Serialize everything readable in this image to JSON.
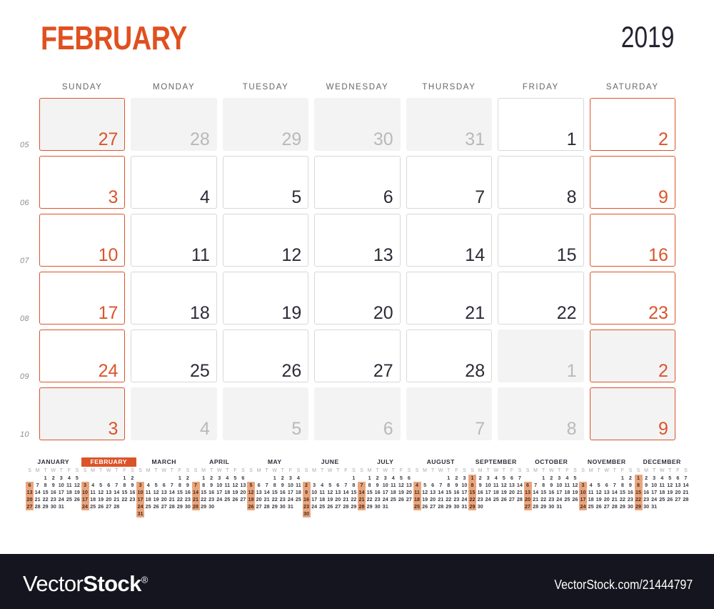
{
  "header": {
    "month": "FEBRUARY",
    "year": "2019",
    "month_color": "#E0501F",
    "year_color": "#232331"
  },
  "accent_color": "#DB5429",
  "weekday_headers": [
    "SUNDAY",
    "MONDAY",
    "TUESDAY",
    "WEDNESDAY",
    "THURSDAY",
    "FRIDAY",
    "SATURDAY"
  ],
  "week_numbers": [
    "05",
    "06",
    "07",
    "08",
    "09",
    "10"
  ],
  "grid": [
    [
      {
        "n": "27",
        "state": "out",
        "weekend": true
      },
      {
        "n": "28",
        "state": "out",
        "weekend": false
      },
      {
        "n": "29",
        "state": "out",
        "weekend": false
      },
      {
        "n": "30",
        "state": "out",
        "weekend": false
      },
      {
        "n": "31",
        "state": "out",
        "weekend": false
      },
      {
        "n": "1",
        "state": "in",
        "weekend": false
      },
      {
        "n": "2",
        "state": "in",
        "weekend": true
      }
    ],
    [
      {
        "n": "3",
        "state": "in",
        "weekend": true
      },
      {
        "n": "4",
        "state": "in",
        "weekend": false
      },
      {
        "n": "5",
        "state": "in",
        "weekend": false
      },
      {
        "n": "6",
        "state": "in",
        "weekend": false
      },
      {
        "n": "7",
        "state": "in",
        "weekend": false
      },
      {
        "n": "8",
        "state": "in",
        "weekend": false
      },
      {
        "n": "9",
        "state": "in",
        "weekend": true
      }
    ],
    [
      {
        "n": "10",
        "state": "in",
        "weekend": true
      },
      {
        "n": "11",
        "state": "in",
        "weekend": false
      },
      {
        "n": "12",
        "state": "in",
        "weekend": false
      },
      {
        "n": "13",
        "state": "in",
        "weekend": false
      },
      {
        "n": "14",
        "state": "in",
        "weekend": false
      },
      {
        "n": "15",
        "state": "in",
        "weekend": false
      },
      {
        "n": "16",
        "state": "in",
        "weekend": true
      }
    ],
    [
      {
        "n": "17",
        "state": "in",
        "weekend": true
      },
      {
        "n": "18",
        "state": "in",
        "weekend": false
      },
      {
        "n": "19",
        "state": "in",
        "weekend": false
      },
      {
        "n": "20",
        "state": "in",
        "weekend": false
      },
      {
        "n": "21",
        "state": "in",
        "weekend": false
      },
      {
        "n": "22",
        "state": "in",
        "weekend": false
      },
      {
        "n": "23",
        "state": "in",
        "weekend": true
      }
    ],
    [
      {
        "n": "24",
        "state": "in",
        "weekend": true
      },
      {
        "n": "25",
        "state": "in",
        "weekend": false
      },
      {
        "n": "26",
        "state": "in",
        "weekend": false
      },
      {
        "n": "27",
        "state": "in",
        "weekend": false
      },
      {
        "n": "28",
        "state": "in",
        "weekend": false
      },
      {
        "n": "1",
        "state": "out",
        "weekend": false
      },
      {
        "n": "2",
        "state": "out",
        "weekend": true
      }
    ],
    [
      {
        "n": "3",
        "state": "out",
        "weekend": true
      },
      {
        "n": "4",
        "state": "out",
        "weekend": false
      },
      {
        "n": "5",
        "state": "out",
        "weekend": false
      },
      {
        "n": "6",
        "state": "out",
        "weekend": false
      },
      {
        "n": "7",
        "state": "out",
        "weekend": false
      },
      {
        "n": "8",
        "state": "out",
        "weekend": false
      },
      {
        "n": "9",
        "state": "out",
        "weekend": true
      }
    ]
  ],
  "mini_dow": [
    "S",
    "M",
    "T",
    "W",
    "T",
    "F",
    "S"
  ],
  "mini_calendars": [
    {
      "name": "JANUARY",
      "current": false,
      "start": 2,
      "days": 31
    },
    {
      "name": "FEBRUARY",
      "current": true,
      "start": 5,
      "days": 28
    },
    {
      "name": "MARCH",
      "current": false,
      "start": 5,
      "days": 31
    },
    {
      "name": "APRIL",
      "current": false,
      "start": 1,
      "days": 30
    },
    {
      "name": "MAY",
      "current": false,
      "start": 3,
      "days": 31
    },
    {
      "name": "JUNE",
      "current": false,
      "start": 6,
      "days": 30
    },
    {
      "name": "JULY",
      "current": false,
      "start": 1,
      "days": 31
    },
    {
      "name": "AUGUST",
      "current": false,
      "start": 4,
      "days": 31
    },
    {
      "name": "SEPTEMBER",
      "current": false,
      "start": 0,
      "days": 30
    },
    {
      "name": "OCTOBER",
      "current": false,
      "start": 2,
      "days": 31
    },
    {
      "name": "NOVEMBER",
      "current": false,
      "start": 5,
      "days": 30
    },
    {
      "name": "DECEMBER",
      "current": false,
      "start": 0,
      "days": 31
    }
  ],
  "footer": {
    "logo_part1": "Vector",
    "logo_part2": "Stock",
    "logo_reg": "®",
    "url": "VectorStock.com/21444797",
    "background": "#15151f"
  }
}
